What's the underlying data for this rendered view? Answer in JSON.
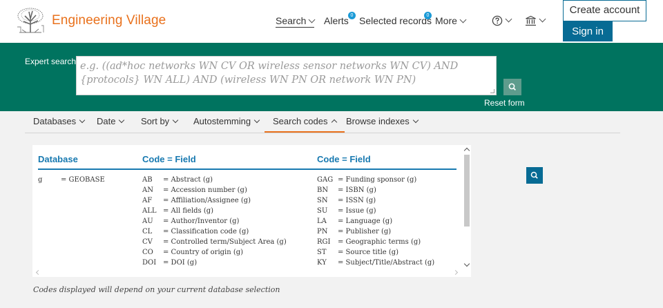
{
  "header": {
    "brand": "Engineering Village",
    "nav": {
      "search": "Search",
      "alerts": "Alerts",
      "alerts_count": "0",
      "selected_records": "Selected records",
      "selected_count": "0",
      "more": "More"
    },
    "create_account": "Create account",
    "sign_in": "Sign in"
  },
  "search": {
    "label": "Expert search:",
    "placeholder": "e.g. ((ad*hoc networks WN CV OR wireless sensor networks WN CV) AND {protocols} WN ALL) AND (wireless WN PN OR network WN PN)",
    "reset": "Reset form"
  },
  "tabs": [
    {
      "label": "Databases"
    },
    {
      "label": "Date"
    },
    {
      "label": "Sort by"
    },
    {
      "label": "Autostemming"
    },
    {
      "label": "Search codes"
    },
    {
      "label": "Browse indexes"
    }
  ],
  "codes": {
    "headers": {
      "database": "Database",
      "code_field_1": "Code = Field",
      "code_field_2": "Code = Field"
    },
    "database": {
      "code": "g",
      "name": "= GEOBASE"
    },
    "col1": [
      {
        "code": "AB",
        "field": "= Abstract (g)"
      },
      {
        "code": "AN",
        "field": "= Accession number (g)"
      },
      {
        "code": "AF",
        "field": "= Affiliation/Assignee (g)"
      },
      {
        "code": "ALL",
        "field": "= All fields (g)"
      },
      {
        "code": "AU",
        "field": "= Author/Inventor (g)"
      },
      {
        "code": "CL",
        "field": "= Classification code (g)"
      },
      {
        "code": "CV",
        "field": "= Controlled term/Subject Area (g)"
      },
      {
        "code": "CO",
        "field": "= Country of origin (g)"
      },
      {
        "code": "DOI",
        "field": "= DOI (g)"
      }
    ],
    "col2": [
      {
        "code": "GAG",
        "field": "= Funding sponsor (g)"
      },
      {
        "code": "BN",
        "field": "= ISBN (g)"
      },
      {
        "code": "SN",
        "field": "= ISSN (g)"
      },
      {
        "code": "SU",
        "field": "= Issue (g)"
      },
      {
        "code": "LA",
        "field": "= Language (g)"
      },
      {
        "code": "PN",
        "field": "= Publisher (g)"
      },
      {
        "code": "RGI",
        "field": "= Geographic terms (g)"
      },
      {
        "code": "ST",
        "field": "= Source title (g)"
      },
      {
        "code": "KY",
        "field": "= Subject/Title/Abstract (g)"
      }
    ],
    "note": "Codes displayed will depend on your current database selection"
  },
  "colors": {
    "brand": "#e9711c",
    "primary": "#076b94",
    "search_band": "#00735f",
    "link": "#1779b0"
  }
}
